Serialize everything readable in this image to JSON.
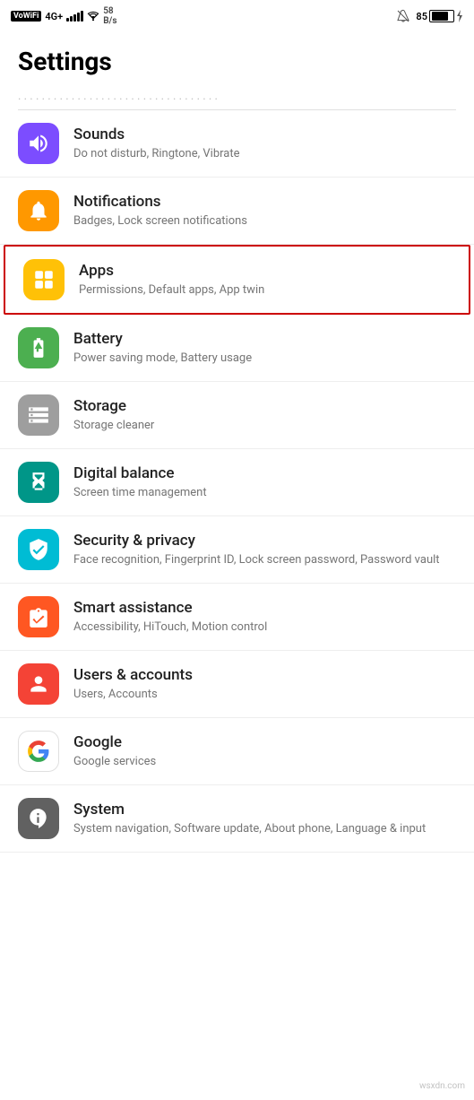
{
  "statusBar": {
    "leftItems": [
      "VoWiFi",
      "4G+",
      "signal",
      "wifi",
      "58 B/s"
    ],
    "speed": "58 B/s",
    "bellMuted": true,
    "batteryLevel": "85",
    "charging": true
  },
  "pageTitle": "Settings",
  "topItemHint": "...",
  "items": [
    {
      "id": "sounds",
      "title": "Sounds",
      "subtitle": "Do not disturb, Ringtone, Vibrate",
      "iconColor": "purple",
      "iconType": "volume"
    },
    {
      "id": "notifications",
      "title": "Notifications",
      "subtitle": "Badges, Lock screen notifications",
      "iconColor": "orange",
      "iconType": "bell"
    },
    {
      "id": "apps",
      "title": "Apps",
      "subtitle": "Permissions, Default apps, App twin",
      "iconColor": "yellow",
      "iconType": "grid",
      "highlighted": true
    },
    {
      "id": "battery",
      "title": "Battery",
      "subtitle": "Power saving mode, Battery usage",
      "iconColor": "green",
      "iconType": "battery"
    },
    {
      "id": "storage",
      "title": "Storage",
      "subtitle": "Storage cleaner",
      "iconColor": "gray",
      "iconType": "storage"
    },
    {
      "id": "digital-balance",
      "title": "Digital balance",
      "subtitle": "Screen time management",
      "iconColor": "teal",
      "iconType": "hourglass"
    },
    {
      "id": "security-privacy",
      "title": "Security & privacy",
      "subtitle": "Face recognition, Fingerprint ID, Lock screen password, Password vault",
      "iconColor": "cyan",
      "iconType": "shield"
    },
    {
      "id": "smart-assistance",
      "title": "Smart assistance",
      "subtitle": "Accessibility, HiTouch, Motion control",
      "iconColor": "red-orange",
      "iconType": "hand"
    },
    {
      "id": "users-accounts",
      "title": "Users & accounts",
      "subtitle": "Users, Accounts",
      "iconColor": "red",
      "iconType": "person"
    },
    {
      "id": "google",
      "title": "Google",
      "subtitle": "Google services",
      "iconColor": "google",
      "iconType": "google"
    },
    {
      "id": "system",
      "title": "System",
      "subtitle": "System navigation, Software update, About phone, Language & input",
      "iconColor": "dark-gray",
      "iconType": "info"
    }
  ]
}
